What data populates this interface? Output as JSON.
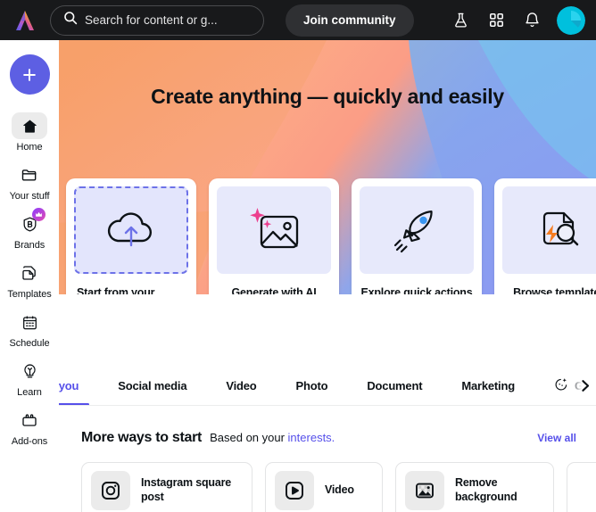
{
  "topbar": {
    "logo_icon": "canva-logo-icon",
    "search": {
      "icon": "search-icon",
      "placeholder": "Search for content or g...",
      "value": ""
    },
    "join_label": "Join community",
    "icons": [
      {
        "name": "flask-icon",
        "label": "Labs"
      },
      {
        "name": "apps-grid-icon",
        "label": "Apps"
      },
      {
        "name": "bell-icon",
        "label": "Notifications"
      }
    ],
    "avatar_name": "user-avatar",
    "avatar_color": "#00c4e0"
  },
  "sidebar": {
    "create_label": "+",
    "items": [
      {
        "label": "Home",
        "icon": "home-icon",
        "active": true,
        "badge": false
      },
      {
        "label": "Your stuff",
        "icon": "folder-icon",
        "active": false,
        "badge": false
      },
      {
        "label": "Brands",
        "icon": "brand-b-icon",
        "active": false,
        "badge": true,
        "badge_icon": "crown-icon"
      },
      {
        "label": "Templates",
        "icon": "templates-icon",
        "active": false,
        "badge": false
      },
      {
        "label": "Schedule",
        "icon": "calendar-icon",
        "active": false,
        "badge": false
      },
      {
        "label": "Learn",
        "icon": "lightbulb-icon",
        "active": false,
        "badge": false
      },
      {
        "label": "Add-ons",
        "icon": "addons-icon",
        "active": false,
        "badge": false
      }
    ]
  },
  "hero": {
    "title": "Create anything — quickly and easily",
    "gradient": {
      "orange": "#f6a05a",
      "peach": "#fba98c",
      "salmon": "#fc9d84",
      "blue": "#7fa8e8",
      "periwinkle": "#8f92f0",
      "cyan": "#6fd4ef"
    }
  },
  "action_cards": [
    {
      "label": "Start from your content",
      "icon": "cloud-upload-icon",
      "style": "dashed"
    },
    {
      "label": "Generate with AI",
      "icon": "ai-image-sparkle-icon",
      "style": "plain"
    },
    {
      "label": "Explore quick actions",
      "icon": "rocket-icon",
      "style": "plain"
    },
    {
      "label": "Browse templates",
      "icon": "document-search-icon",
      "style": "plain"
    }
  ],
  "tabs": {
    "items": [
      {
        "label": "For you",
        "active": true,
        "icon": null
      },
      {
        "label": "Social media",
        "active": false,
        "icon": null
      },
      {
        "label": "Video",
        "active": false,
        "icon": null
      },
      {
        "label": "Photo",
        "active": false,
        "icon": null
      },
      {
        "label": "Document",
        "active": false,
        "icon": null
      },
      {
        "label": "Marketing",
        "active": false,
        "icon": null
      },
      {
        "label": "Generate",
        "active": false,
        "icon": "magic-sparkle-icon"
      }
    ],
    "next_icon": "chevron-right-icon"
  },
  "more": {
    "title": "More ways to start",
    "subtitle_prefix": "Based on your ",
    "subtitle_link": "interests.",
    "view_all": "View all",
    "cards": [
      {
        "label": "Instagram square post",
        "icon": "instagram-icon"
      },
      {
        "label": "Video",
        "icon": "video-play-icon"
      },
      {
        "label": "Remove background",
        "icon": "remove-background-icon"
      },
      {
        "label": "",
        "icon": ""
      }
    ]
  }
}
